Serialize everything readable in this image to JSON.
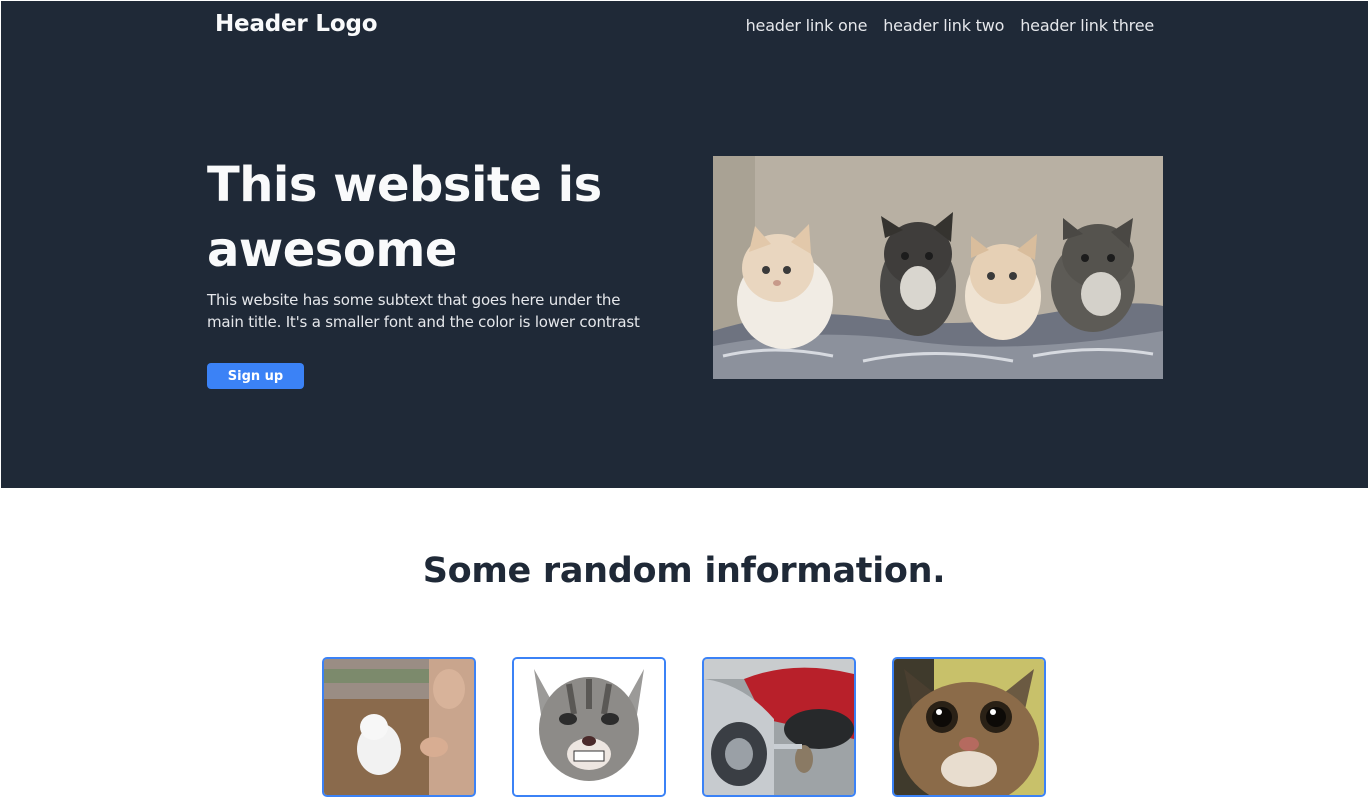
{
  "header": {
    "logo": "Header Logo",
    "links": [
      "header link one",
      "header link two",
      "header link three"
    ]
  },
  "hero": {
    "title": "This website is awesome",
    "subtext": "This website has some subtext that goes here under the main title. It's a smaller font and the color is lower contrast",
    "cta_label": "Sign up",
    "image_alt": "four kittens on a blanket"
  },
  "info": {
    "title": "Some random information.",
    "cards": [
      {
        "image_alt": "white kitten with person"
      },
      {
        "image_alt": "grinning kitten"
      },
      {
        "image_alt": "cat with wrench by car"
      },
      {
        "image_alt": "close-up cat face"
      }
    ]
  },
  "colors": {
    "hero_bg": "#1f2937",
    "accent": "#3b82f6",
    "text_dark": "#1f2937",
    "text_light": "#f9fafb"
  }
}
